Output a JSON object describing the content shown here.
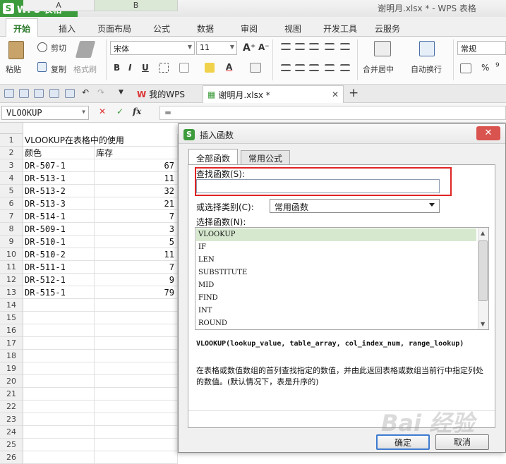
{
  "app": {
    "name": "WPS 表格",
    "doc_title": "谢明月.xlsx * - WPS 表格"
  },
  "menu": {
    "tabs": [
      "开始",
      "插入",
      "页面布局",
      "公式",
      "数据",
      "审阅",
      "视图",
      "开发工具",
      "云服务"
    ]
  },
  "ribbon": {
    "cut": "剪切",
    "paste": "粘贴",
    "copy": "复制",
    "format_painter": "格式刷",
    "font_name": "宋体",
    "font_size": "11",
    "merge_center": "合并居中",
    "wrap_text": "自动换行",
    "number_format": "常规"
  },
  "tabs": {
    "wps": "我的WPS",
    "file": "谢明月.xlsx *"
  },
  "formula_bar": {
    "name_box": "VLOOKUP",
    "fx": "fx",
    "content": "="
  },
  "sheet": {
    "columns": [
      "A",
      "B"
    ],
    "rows": [
      {
        "n": "1",
        "a": "VLOOKUP在表格中的使用",
        "b": ""
      },
      {
        "n": "2",
        "a": "颜色",
        "b": "库存"
      },
      {
        "n": "3",
        "a": "DR-507-1",
        "b": "67"
      },
      {
        "n": "4",
        "a": "DR-513-1",
        "b": "11"
      },
      {
        "n": "5",
        "a": "DR-513-2",
        "b": "32"
      },
      {
        "n": "6",
        "a": "DR-513-3",
        "b": "21"
      },
      {
        "n": "7",
        "a": "DR-514-1",
        "b": "7"
      },
      {
        "n": "8",
        "a": "DR-509-1",
        "b": "3"
      },
      {
        "n": "9",
        "a": "DR-510-1",
        "b": "5"
      },
      {
        "n": "10",
        "a": "DR-510-2",
        "b": "11"
      },
      {
        "n": "11",
        "a": "DR-511-1",
        "b": "7"
      },
      {
        "n": "12",
        "a": "DR-512-1",
        "b": "9"
      },
      {
        "n": "13",
        "a": "DR-515-1",
        "b": "79"
      },
      {
        "n": "14",
        "a": "",
        "b": ""
      },
      {
        "n": "15",
        "a": "",
        "b": ""
      },
      {
        "n": "16",
        "a": "",
        "b": ""
      },
      {
        "n": "17",
        "a": "",
        "b": ""
      },
      {
        "n": "18",
        "a": "",
        "b": ""
      },
      {
        "n": "19",
        "a": "",
        "b": ""
      },
      {
        "n": "20",
        "a": "",
        "b": ""
      },
      {
        "n": "21",
        "a": "",
        "b": ""
      },
      {
        "n": "22",
        "a": "",
        "b": ""
      },
      {
        "n": "23",
        "a": "",
        "b": ""
      },
      {
        "n": "24",
        "a": "",
        "b": ""
      },
      {
        "n": "25",
        "a": "",
        "b": ""
      },
      {
        "n": "26",
        "a": "",
        "b": ""
      }
    ]
  },
  "dialog": {
    "title": "插入函数",
    "tabs": [
      "全部函数",
      "常用公式"
    ],
    "search_label": "查找函数(S):",
    "search_value": "",
    "category_label": "或选择类别(C):",
    "category_value": "常用函数",
    "select_label": "选择函数(N):",
    "functions": [
      "VLOOKUP",
      "IF",
      "LEN",
      "SUBSTITUTE",
      "MID",
      "FIND",
      "INT",
      "ROUND"
    ],
    "syntax": "VLOOKUP(lookup_value, table_array, col_index_num, range_lookup)",
    "description": "在表格或数值数组的首列查找指定的数值，并由此返回表格或数组当前行中指定列处的数值。(默认情况下，表是升序的)",
    "ok": "确定",
    "cancel": "取消"
  },
  "watermark": "Bai 经验",
  "colors": {
    "brand_green": "#3c9b3c",
    "highlight_red": "#e02424",
    "selection": "#d6e9cf"
  }
}
